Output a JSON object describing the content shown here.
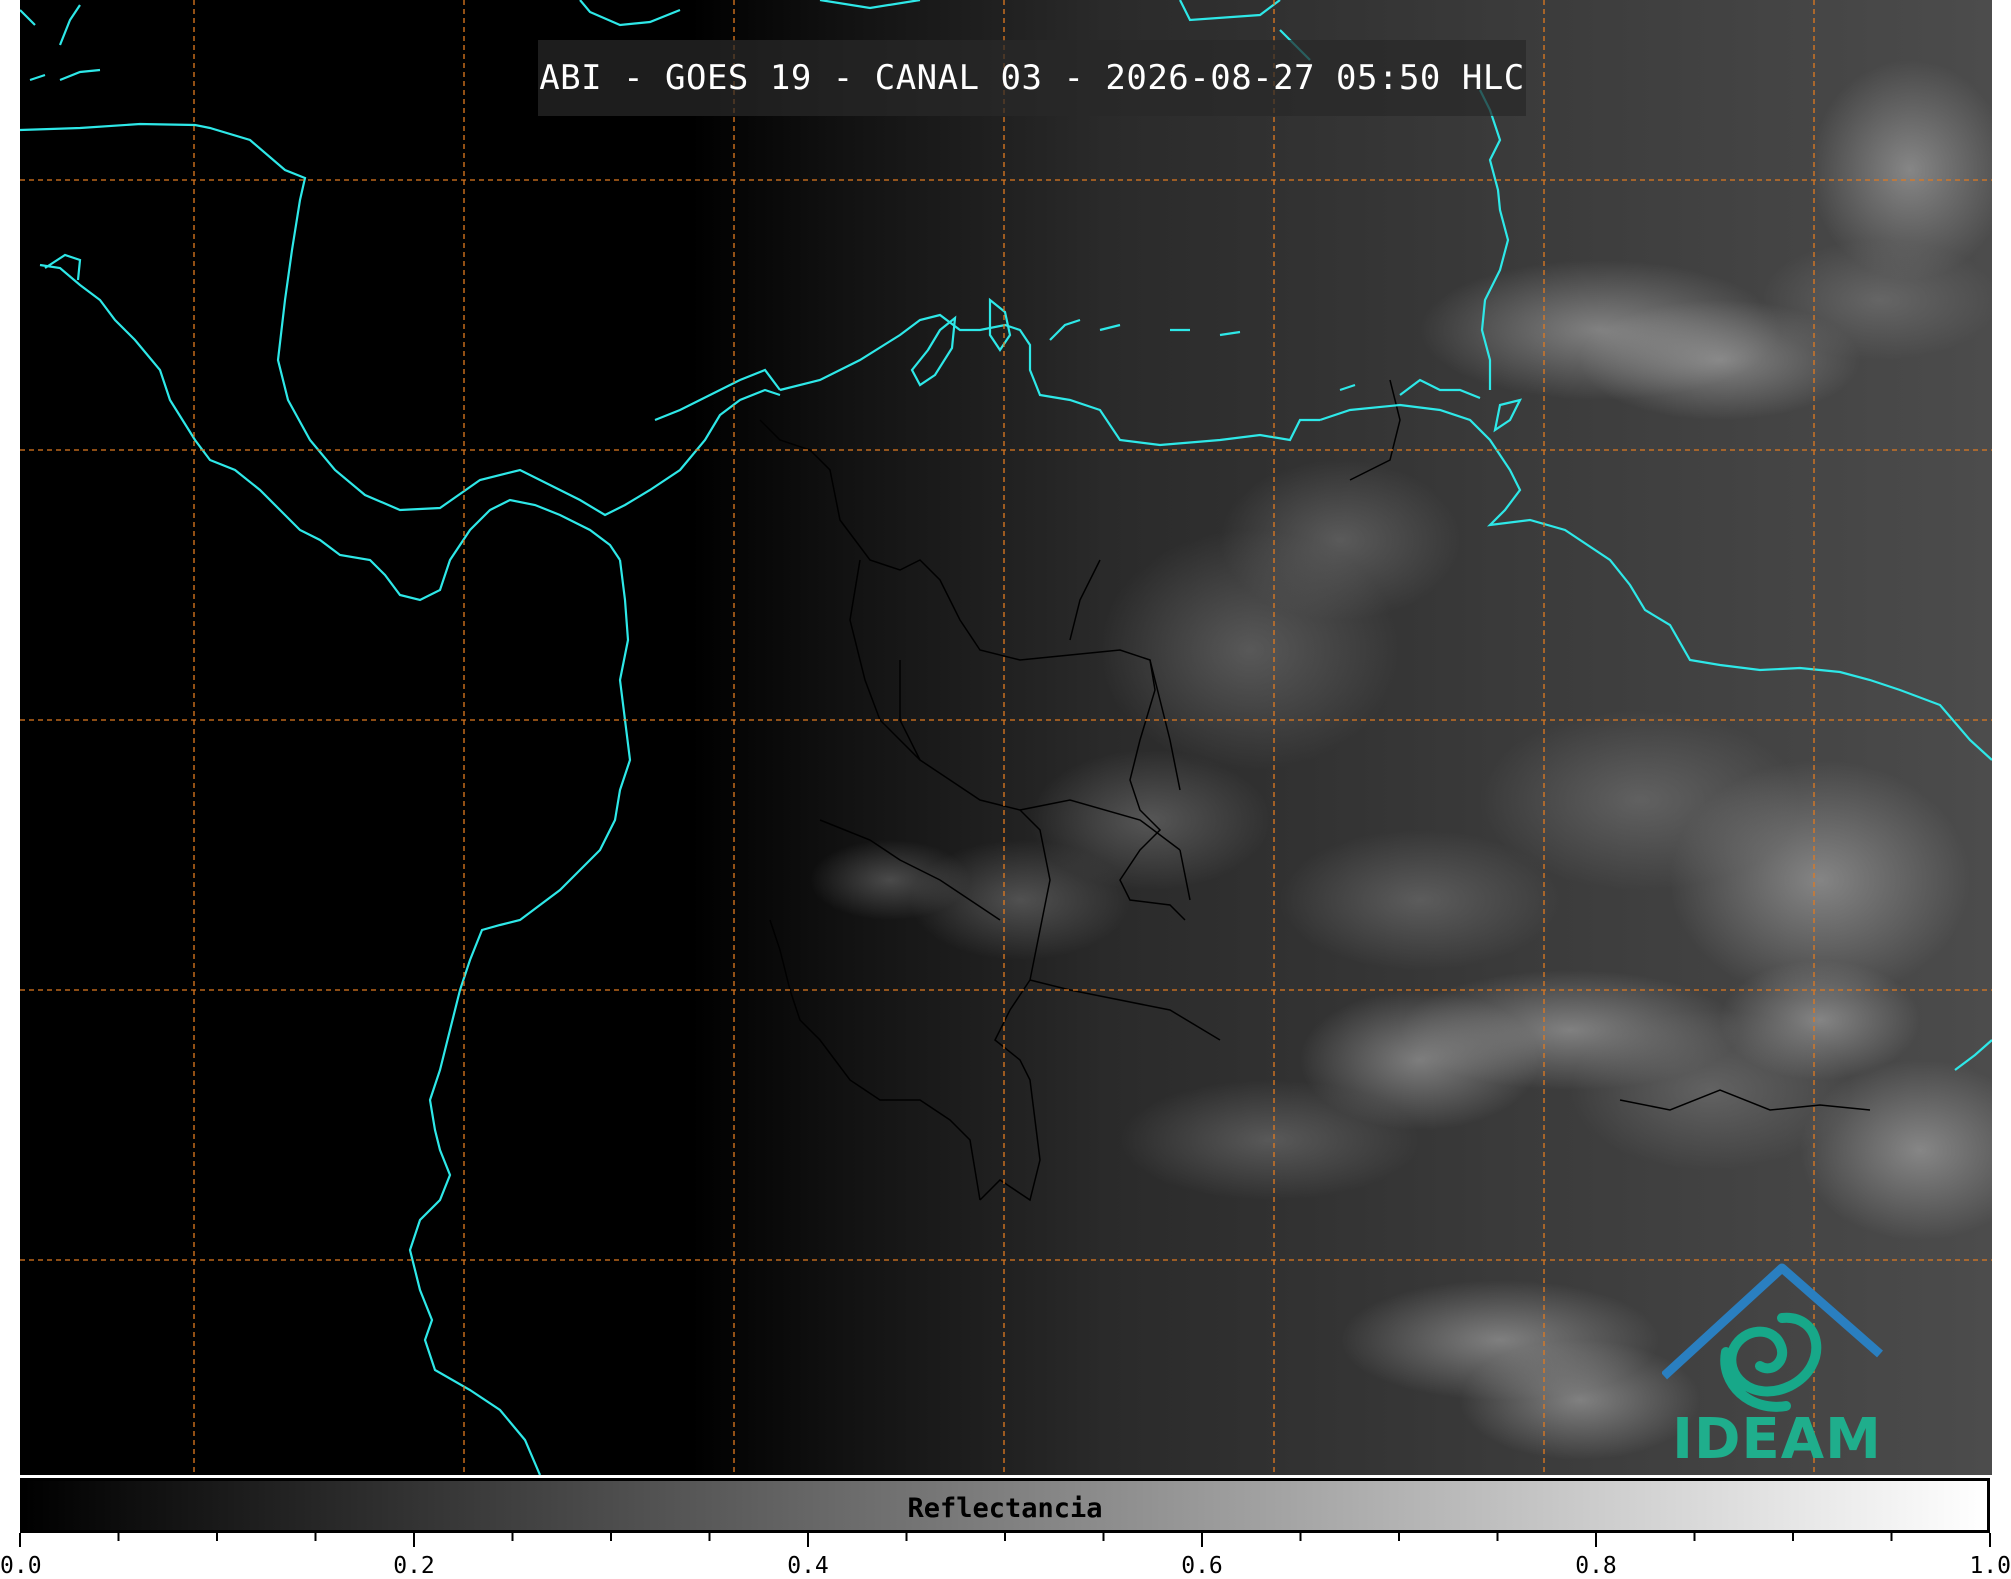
{
  "title": "ABI - GOES 19 - CANAL 03 - 2026-08-27 05:50 HLC",
  "colorbar": {
    "label": "Reflectancia",
    "tick_labels": [
      "0.0",
      "0.2",
      "0.4",
      "0.6",
      "0.8",
      "1.0"
    ],
    "min": 0.0,
    "max": 1.0,
    "colormap": [
      "#000000",
      "#ffffff"
    ]
  },
  "logo": {
    "text": "IDEAM",
    "colors": {
      "mountain": "#2a7fc0",
      "swirl": "#17a889",
      "text": "#1fae8c"
    }
  },
  "map": {
    "coastline_color": "#2ee8e8",
    "gridline_color": "#e07a20",
    "gridline_style": "dashed",
    "border_color": "#000000",
    "background_night": "#000000",
    "background_day": "#4a4a4a"
  }
}
